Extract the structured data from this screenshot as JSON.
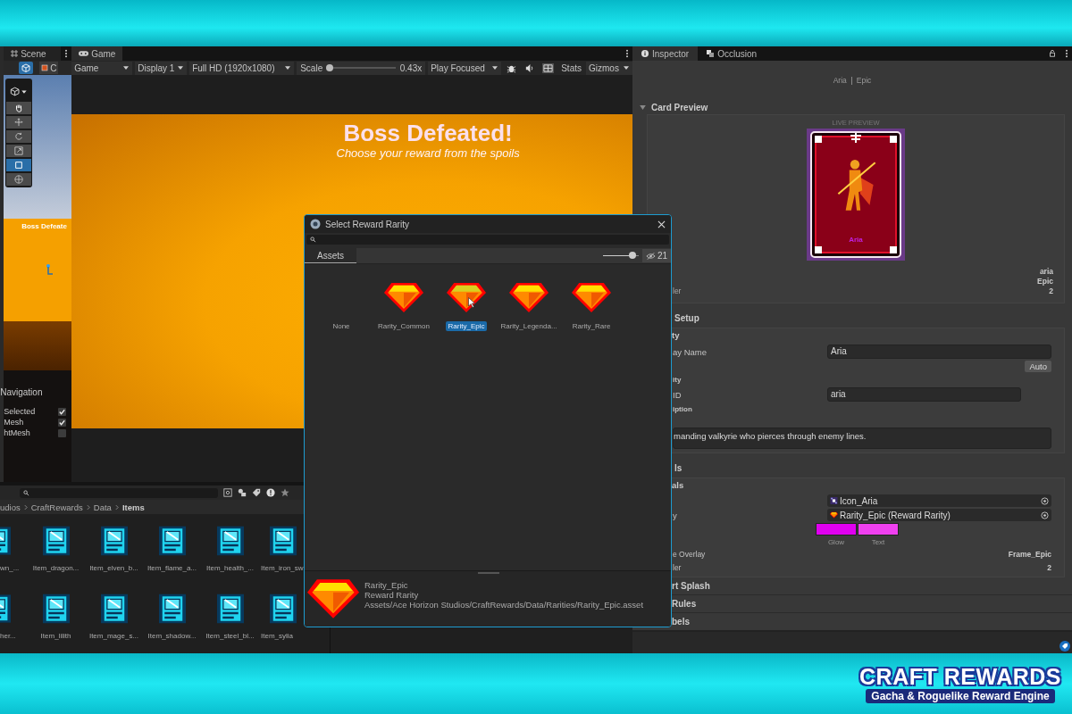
{
  "scene_panel": {
    "tab": "Scene",
    "toolbar_button": "C",
    "tools": [
      {
        "kind": "hand",
        "selected": false
      },
      {
        "kind": "move",
        "selected": false
      },
      {
        "kind": "rotate",
        "selected": false
      },
      {
        "kind": "scale",
        "selected": false
      },
      {
        "kind": "rect",
        "selected": true
      },
      {
        "kind": "transform",
        "selected": false
      }
    ],
    "preview_title": "Boss Defeate",
    "navigation": {
      "title": "Navigation",
      "rows": [
        {
          "label": "Selected",
          "checked": true
        },
        {
          "label": "Mesh",
          "checked": true
        },
        {
          "label": "htMesh",
          "checked": false
        }
      ]
    }
  },
  "game_panel": {
    "tab": "Game",
    "view": "Game",
    "display": "Display 1",
    "resolution": "Full HD (1920x1080)",
    "scale_label": "Scale",
    "scale": {
      "level": 0
    },
    "scale_value": "0.43x",
    "play_mode": "Play Focused",
    "stats": "Stats",
    "gizmos": "Gizmos",
    "title": "Boss Defeated!",
    "subtitle": "Choose your reward from the spoils"
  },
  "project": {
    "breadcrumb": [
      "udios",
      "CraftRewards",
      "Data",
      "Items"
    ],
    "items": [
      "wn_...",
      "Item_dragon...",
      "Item_elven_b...",
      "Item_flame_a...",
      "Item_health_...",
      "Item_iron_sw",
      "her...",
      "Item_lilith",
      "Item_mage_s...",
      "Item_shadow...",
      "Item_steel_bl...",
      "Item_sylia"
    ]
  },
  "dialog": {
    "title": "Select Reward Rarity",
    "tab": "Assets",
    "zoom": {
      "level": 0.75
    },
    "count": "21",
    "items": [
      {
        "label": "None",
        "kind": "none",
        "selected": false
      },
      {
        "label": "Rarity_Common",
        "kind": "asset",
        "selected": false
      },
      {
        "label": "Rarity_Epic",
        "kind": "asset",
        "selected": true
      },
      {
        "label": "Rarity_Legenda...",
        "kind": "asset",
        "selected": false
      },
      {
        "label": "Rarity_Rare",
        "kind": "asset",
        "selected": false
      }
    ],
    "details": {
      "name": "Rarity_Epic",
      "type": "Reward Rarity",
      "path": "Assets/Ace Horizon Studios/CraftRewards/Data/Rarities/Rarity_Epic.asset"
    }
  },
  "inspector": {
    "tabs": [
      {
        "label": "Inspector",
        "selected": true
      },
      {
        "label": "Occlusion",
        "selected": false
      }
    ],
    "header": {
      "name": "Aria",
      "rarity": "Epic"
    },
    "card_preview": {
      "title": "Card Preview",
      "expanded": true,
      "caption": "LIVE PREVIEW",
      "card_name": "Aria",
      "rows": [
        {
          "value": "aria"
        },
        {
          "value": "Epic"
        },
        {
          "label": "ler",
          "value": "2"
        }
      ]
    },
    "setup": {
      "title": "Setup",
      "group": "ty",
      "rows": [
        {
          "kind": "text",
          "label": "ay Name",
          "value": "Aria"
        },
        {
          "kind": "button",
          "label": "Auto"
        },
        {
          "kind": "heading",
          "label": "ity"
        },
        {
          "kind": "text",
          "label": "ID",
          "value": "aria"
        },
        {
          "kind": "heading",
          "label": "iption"
        },
        {
          "kind": "area",
          "value": "manding valkyrie who pierces through enemy lines."
        }
      ]
    },
    "visuals": {
      "title": "ls",
      "group": "als",
      "rows": [
        {
          "kind": "object",
          "value": "Icon_Aria"
        },
        {
          "kind": "object",
          "label": "y",
          "value": "Rarity_Epic (Reward Rarity)"
        },
        {
          "kind": "colors",
          "swatches": [
            {
              "label": "Glow",
              "color": "#e000f0"
            },
            {
              "label": "Text",
              "color": "#f040f0"
            }
          ]
        },
        {
          "kind": "value",
          "label": "e Overlay",
          "value": "Frame_Epic"
        },
        {
          "kind": "value",
          "label": "ler",
          "value": "2"
        }
      ]
    },
    "foldouts": [
      "rt Splash",
      "Rules",
      "bels"
    ]
  },
  "branding": {
    "title": "CRAFT REWARDS",
    "tagline": "Gacha & Roguelike Reward Engine"
  }
}
